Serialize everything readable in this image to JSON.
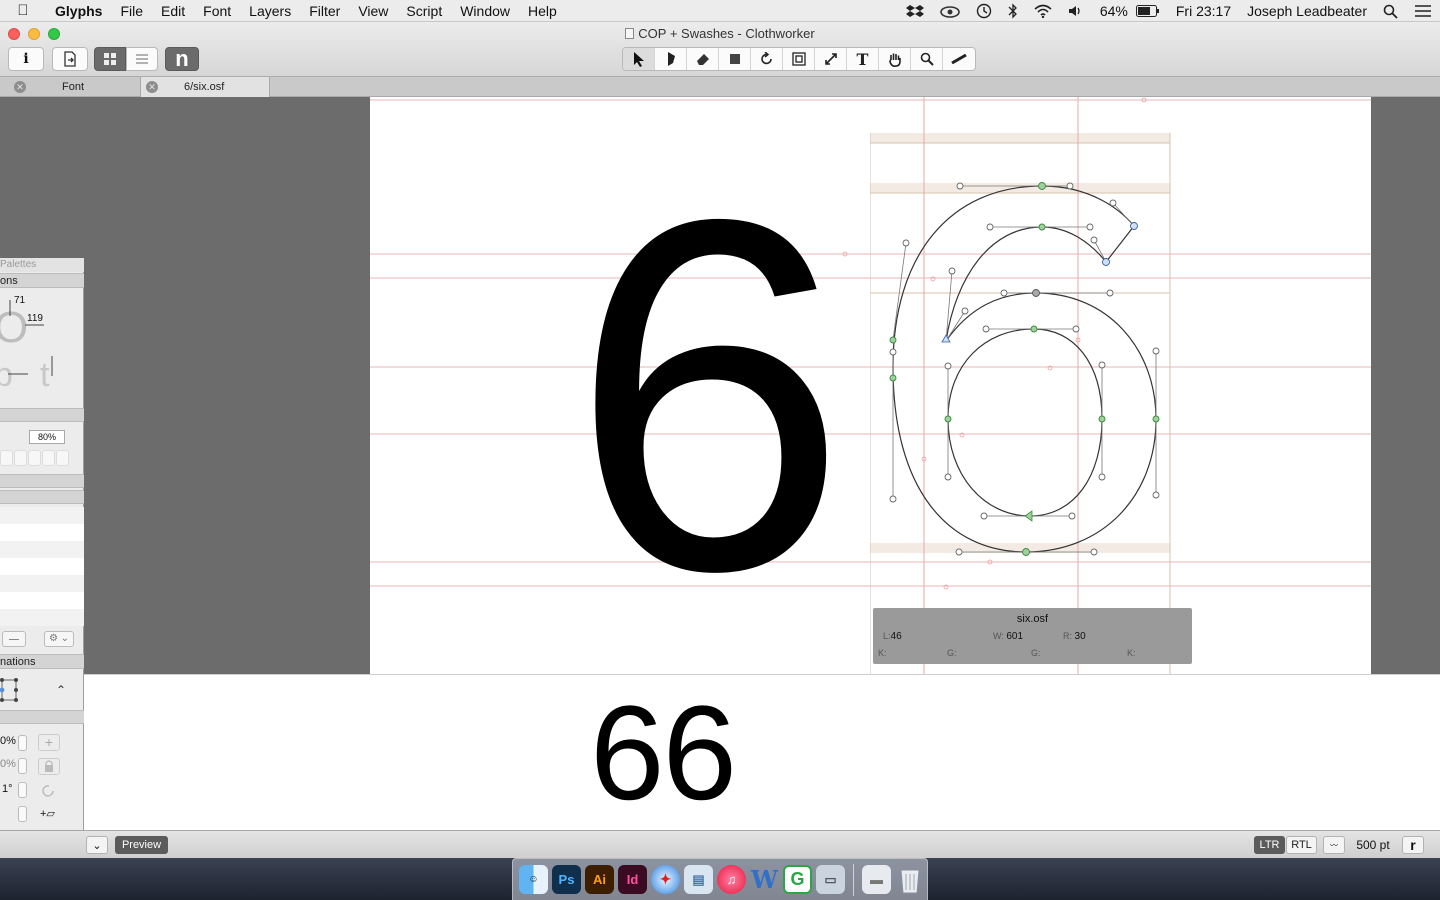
{
  "menubar": {
    "app_name": "Glyphs",
    "menus": [
      "File",
      "Edit",
      "Font",
      "Layers",
      "Filter",
      "View",
      "Script",
      "Window",
      "Help"
    ],
    "battery": "64%",
    "clock": "Fri 23:17",
    "user": "Joseph Leadbeater"
  },
  "window": {
    "title": "COP + Swashes - Clothworker",
    "toolbar_glyph": "n"
  },
  "tabs": [
    {
      "label": "Font"
    },
    {
      "label": "6/six.osf"
    }
  ],
  "canvas": {
    "big_glyph": "6",
    "preview_text": "66"
  },
  "glyph_info": {
    "name": "six.osf",
    "l_label": "L:",
    "l_value": "46",
    "w_label": "W:",
    "w_value": "601",
    "r_label": "R:",
    "r_value": "30",
    "k_label": "K:",
    "g_label": "G:"
  },
  "palette": {
    "title": "Palettes",
    "section_dimensions": "ons",
    "dim_top": "71",
    "dim_right": "119",
    "zoom_field": "80%",
    "section_transformations": "nations",
    "field_percent_1": "0%",
    "field_percent_2": "0%",
    "field_angle": "1°"
  },
  "bottombar": {
    "preview_label": "Preview",
    "ltr": "LTR",
    "rtl": "RTL",
    "font_size": "500 pt"
  },
  "dock": {
    "apps": [
      "Finder",
      "Ps",
      "Ai",
      "Id",
      "Safari",
      "Preview",
      "iTunes",
      "Word",
      "Glyphs",
      "Photos",
      "Documents",
      "Trash"
    ]
  }
}
